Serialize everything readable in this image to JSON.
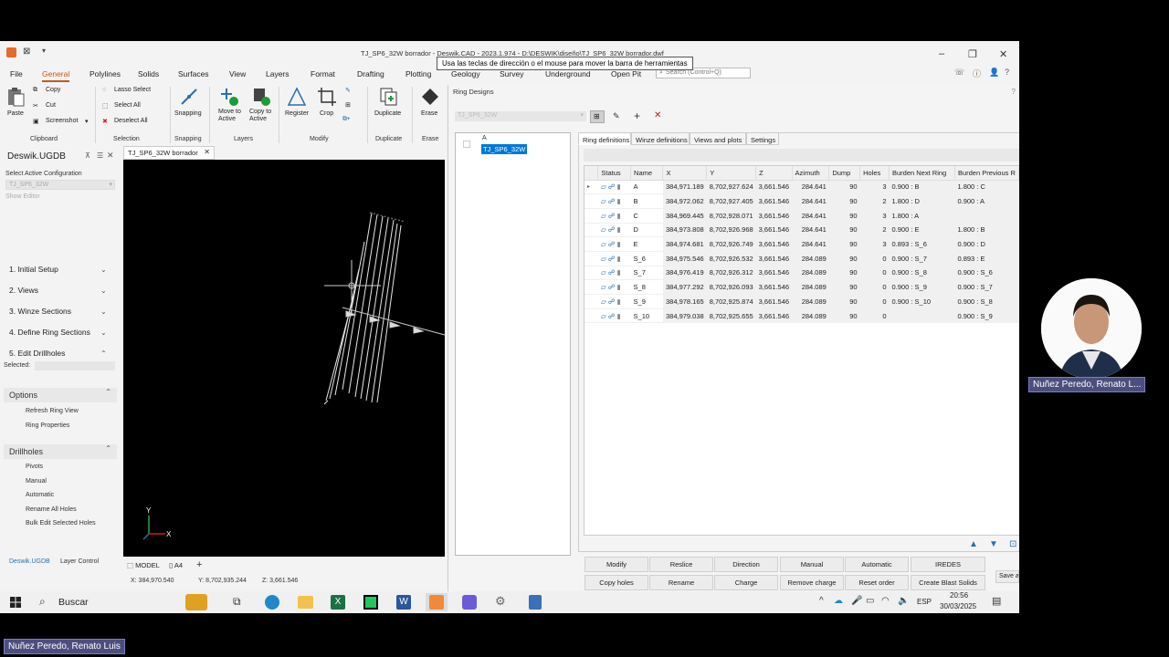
{
  "window": {
    "title": "TJ_SP6_32W borrador - Deswik.CAD - 2023.1.974 - D:\\DESWIK\\diseño\\TJ_SP6_32W borrador.dwf",
    "tooltip": "Usa las teclas de dirección o el mouse para mover la barra de herramientas",
    "search_placeholder": "Search (Control+Q)"
  },
  "menu": {
    "file": "File",
    "general": "General",
    "polylines": "Polylines",
    "solids": "Solids",
    "surfaces": "Surfaces",
    "view": "View",
    "layers": "Layers",
    "format": "Format",
    "drafting": "Drafting",
    "plotting": "Plotting",
    "geology": "Geology",
    "survey": "Survey",
    "underground": "Underground",
    "openpit": "Open Pit"
  },
  "ribbon": {
    "paste": "Paste",
    "copy": "Copy",
    "cut": "Cut",
    "screenshot": "Screenshot",
    "clipboard": "Clipboard",
    "lasso": "Lasso Select",
    "select_all": "Select All",
    "deselect_all": "Deselect All",
    "selection": "Selection",
    "snapping_btn": "Snapping",
    "snapping": "Snapping",
    "move_to": "Move to",
    "active": "Active",
    "copy_to": "Copy to",
    "active2": "Active",
    "layers": "Layers",
    "register": "Register",
    "crop": "Crop",
    "modify": "Modify",
    "duplicate_btn": "Duplicate",
    "duplicate": "Duplicate",
    "erase_btn": "Erase",
    "erase": "Erase"
  },
  "leftpanel": {
    "title": "Deswik.UGDB",
    "select_config": "Select Active Configuration",
    "config_value": "TJ_SP6_32W",
    "show_editor": "Show Editor",
    "items": [
      "1. Initial Setup",
      "2. Views",
      "3. Winze Sections",
      "4. Define Ring Sections",
      "5. Edit Drillholes"
    ],
    "selected_label": "Selected:",
    "options": "Options",
    "options_items": [
      "Refresh Ring View",
      "Ring Properties"
    ],
    "drillholes": "Drillholes",
    "drillholes_items": [
      "Pivots",
      "Manual",
      "Automatic",
      "Rename All Holes",
      "Bulk Edit Selected Holes"
    ],
    "bottom_tabs": [
      "Deswik.UGDB",
      "Layer Control"
    ]
  },
  "viewport": {
    "tab": "TJ_SP6_32W borrador",
    "model_tab": "MODEL",
    "a4_tab": "A4",
    "axis_y": "Y",
    "axis_x": "X",
    "coord_x": "X: 384,970.540",
    "coord_y": "Y: 8,702,935.244",
    "coord_z": "Z: 3,661.546"
  },
  "dialog": {
    "title": "Ring Designs",
    "combo_value": "TJ_SP6_32W",
    "tree_root": "A",
    "tree_selected": "TJ_SP6_32W",
    "tabs": [
      "Ring definitions",
      "Winze definitions",
      "Views and plots",
      "Settings"
    ],
    "columns": [
      "Status",
      "Name",
      "X",
      "Y",
      "Z",
      "Azimuth",
      "Dump",
      "Holes",
      "Burden Next Ring",
      "Burden Previous R"
    ],
    "rows": [
      {
        "name": "A",
        "x": "384,971.189",
        "y": "8,702,927.624",
        "z": "3,661.546",
        "az": "284.641",
        "dump": "90",
        "holes": "3",
        "bnext": "0.900 : B",
        "bprev": "1.800 : C"
      },
      {
        "name": "B",
        "x": "384,972.062",
        "y": "8,702,927.405",
        "z": "3,661.546",
        "az": "284.641",
        "dump": "90",
        "holes": "2",
        "bnext": "1.800 : D",
        "bprev": "0.900 : A"
      },
      {
        "name": "C",
        "x": "384,969.445",
        "y": "8,702,928.071",
        "z": "3,661.546",
        "az": "284.641",
        "dump": "90",
        "holes": "3",
        "bnext": "1.800 : A",
        "bprev": ""
      },
      {
        "name": "D",
        "x": "384,973.808",
        "y": "8,702,926.968",
        "z": "3,661.546",
        "az": "284.641",
        "dump": "90",
        "holes": "2",
        "bnext": "0.900 : E",
        "bprev": "1.800 : B"
      },
      {
        "name": "E",
        "x": "384,974.681",
        "y": "8,702,926.749",
        "z": "3,661.546",
        "az": "284.641",
        "dump": "90",
        "holes": "3",
        "bnext": "0.893 : S_6",
        "bprev": "0.900 : D"
      },
      {
        "name": "S_6",
        "x": "384,975.546",
        "y": "8,702,926.532",
        "z": "3,661.546",
        "az": "284.089",
        "dump": "90",
        "holes": "0",
        "bnext": "0.900 : S_7",
        "bprev": "0.893 : E"
      },
      {
        "name": "S_7",
        "x": "384,976.419",
        "y": "8,702,926.312",
        "z": "3,661.546",
        "az": "284.089",
        "dump": "90",
        "holes": "0",
        "bnext": "0.900 : S_8",
        "bprev": "0.900 : S_6"
      },
      {
        "name": "S_8",
        "x": "384,977.292",
        "y": "8,702,926.093",
        "z": "3,661.546",
        "az": "284.089",
        "dump": "90",
        "holes": "0",
        "bnext": "0.900 : S_9",
        "bprev": "0.900 : S_7"
      },
      {
        "name": "S_9",
        "x": "384,978.165",
        "y": "8,702,925.874",
        "z": "3,661.546",
        "az": "284.089",
        "dump": "90",
        "holes": "0",
        "bnext": "0.900 : S_10",
        "bprev": "0.900 : S_8"
      },
      {
        "name": "S_10",
        "x": "384,979.038",
        "y": "8,702,925.655",
        "z": "3,661.546",
        "az": "284.089",
        "dump": "90",
        "holes": "0",
        "bnext": "",
        "bprev": "0.900 : S_9"
      }
    ],
    "buttons_row1": [
      "Modify",
      "Reslice",
      "Direction",
      "Manual",
      "Automatic",
      "IREDES"
    ],
    "buttons_row2": [
      "Copy holes",
      "Rename",
      "Charge",
      "Remove charge",
      "Reset order",
      "Create Blast Solids"
    ],
    "save": "Save a"
  },
  "taskbar": {
    "search": "Buscar",
    "lang": "ESP",
    "time": "20:56",
    "date": "30/03/2025"
  },
  "presenter": {
    "name_short": "Nuñez Peredo, Renato L...",
    "name_full": "Nuñez Peredo, Renato Luis"
  },
  "colors": {
    "accent": "#c45a1c",
    "selection": "#0078d7",
    "name_label_bg": "#4b4e7e"
  }
}
